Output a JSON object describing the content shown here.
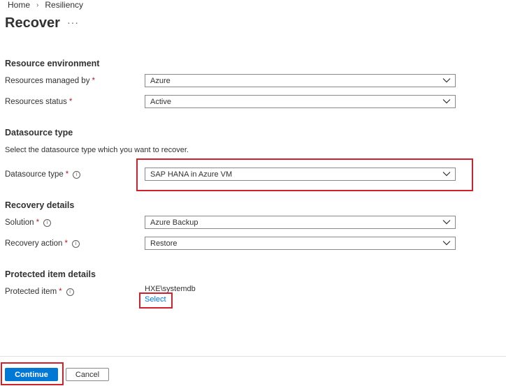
{
  "breadcrumb": {
    "home": "Home",
    "current": "Resiliency"
  },
  "page": {
    "title": "Recover",
    "more": "···"
  },
  "sections": {
    "resource_environment": "Resource environment",
    "datasource_type": "Datasource type",
    "recovery_details": "Recovery details",
    "protected_item_details": "Protected item details"
  },
  "fields": {
    "resources_managed_by": {
      "label": "Resources managed by",
      "value": "Azure"
    },
    "resources_status": {
      "label": "Resources status",
      "value": "Active"
    },
    "datasource_hint": "Select the datasource type which you want to recover.",
    "datasource_type": {
      "label": "Datasource type",
      "value": "SAP HANA in Azure VM"
    },
    "solution": {
      "label": "Solution",
      "value": "Azure Backup"
    },
    "recovery_action": {
      "label": "Recovery action",
      "value": "Restore"
    },
    "protected_item": {
      "label": "Protected item",
      "value": "HXE\\systemdb",
      "link": "Select"
    }
  },
  "required_marker": "*",
  "info_glyph": "i",
  "footer": {
    "continue_label": "Continue",
    "cancel_label": "Cancel"
  },
  "colors": {
    "primary": "#0078d4",
    "highlight": "#d0202a",
    "required": "#a4262c"
  }
}
